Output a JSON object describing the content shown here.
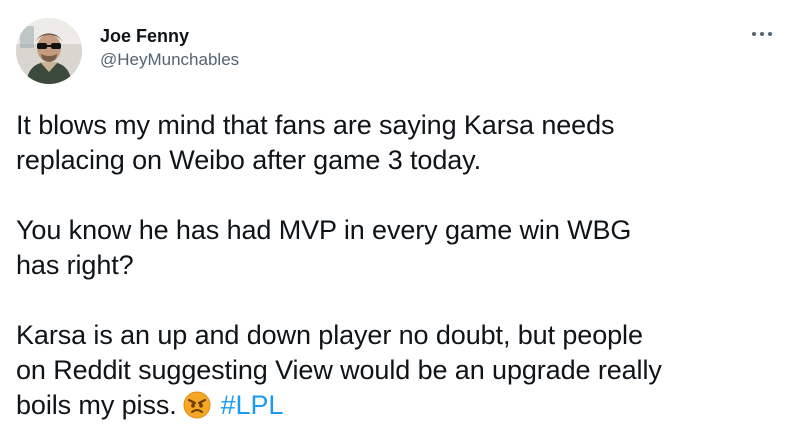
{
  "author": {
    "display_name": "Joe Fenny",
    "handle": "@HeyMunchables",
    "avatar_icon": "profile-photo-avatar"
  },
  "menu": {
    "more_icon": "more-options-icon"
  },
  "tweet": {
    "paragraphs": [
      {
        "lines": [
          "It blows my mind that fans are saying Karsa needs",
          "replacing on Weibo after game 3 today."
        ]
      },
      {
        "lines": [
          "You know he has had MVP in every game win WBG",
          "has right?"
        ]
      },
      {
        "lines": [
          "Karsa is an up and down player no doubt, but people",
          "on Reddit suggesting View would be an upgrade really"
        ],
        "last_line_text": "boils my piss.",
        "emoji": "angry-face-emoji",
        "hashtag": "#LPL"
      }
    ]
  },
  "colors": {
    "text": "#0f1419",
    "secondary_text": "#536471",
    "link": "#1d9bf0",
    "background": "#ffffff"
  }
}
